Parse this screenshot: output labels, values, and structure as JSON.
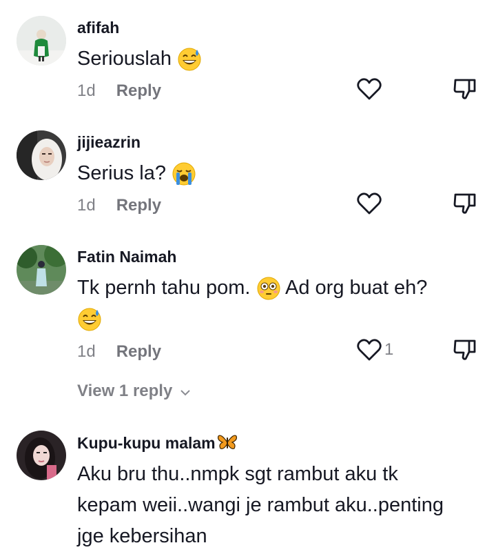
{
  "comments": [
    {
      "username": "afifah",
      "text": "Seriouslah",
      "emoji": "grinning-sweat-emoji",
      "time": "1d",
      "reply_label": "Reply"
    },
    {
      "username": "jijieazrin",
      "text": "Serius la?",
      "emoji": "loudly-crying-emoji",
      "time": "1d",
      "reply_label": "Reply"
    },
    {
      "username": "Fatin Naimah",
      "text_part1": "Tk pernh tahu pom.",
      "text_part2": "Ad org buat eh?",
      "emojis": [
        "flushed-emoji",
        "grinning-sweat-emoji"
      ],
      "time": "1d",
      "reply_label": "Reply",
      "like_count": "1",
      "view_replies_label": "View 1 reply"
    },
    {
      "username": "Kupu-kupu malam",
      "username_emoji": "butterfly-emoji",
      "line1": "Aku bru thu..nmpk sgt rambut aku tk",
      "line2": "kepam weii..wangi je rambut aku..penting",
      "line3": "jge kebersihan"
    }
  ],
  "icons": {
    "like": "heart-outline-icon",
    "dislike": "thumbs-down-icon",
    "expand": "chevron-down-icon"
  },
  "colors": {
    "text": "#161823",
    "muted": "#8a8b91",
    "icon": "#161823"
  }
}
